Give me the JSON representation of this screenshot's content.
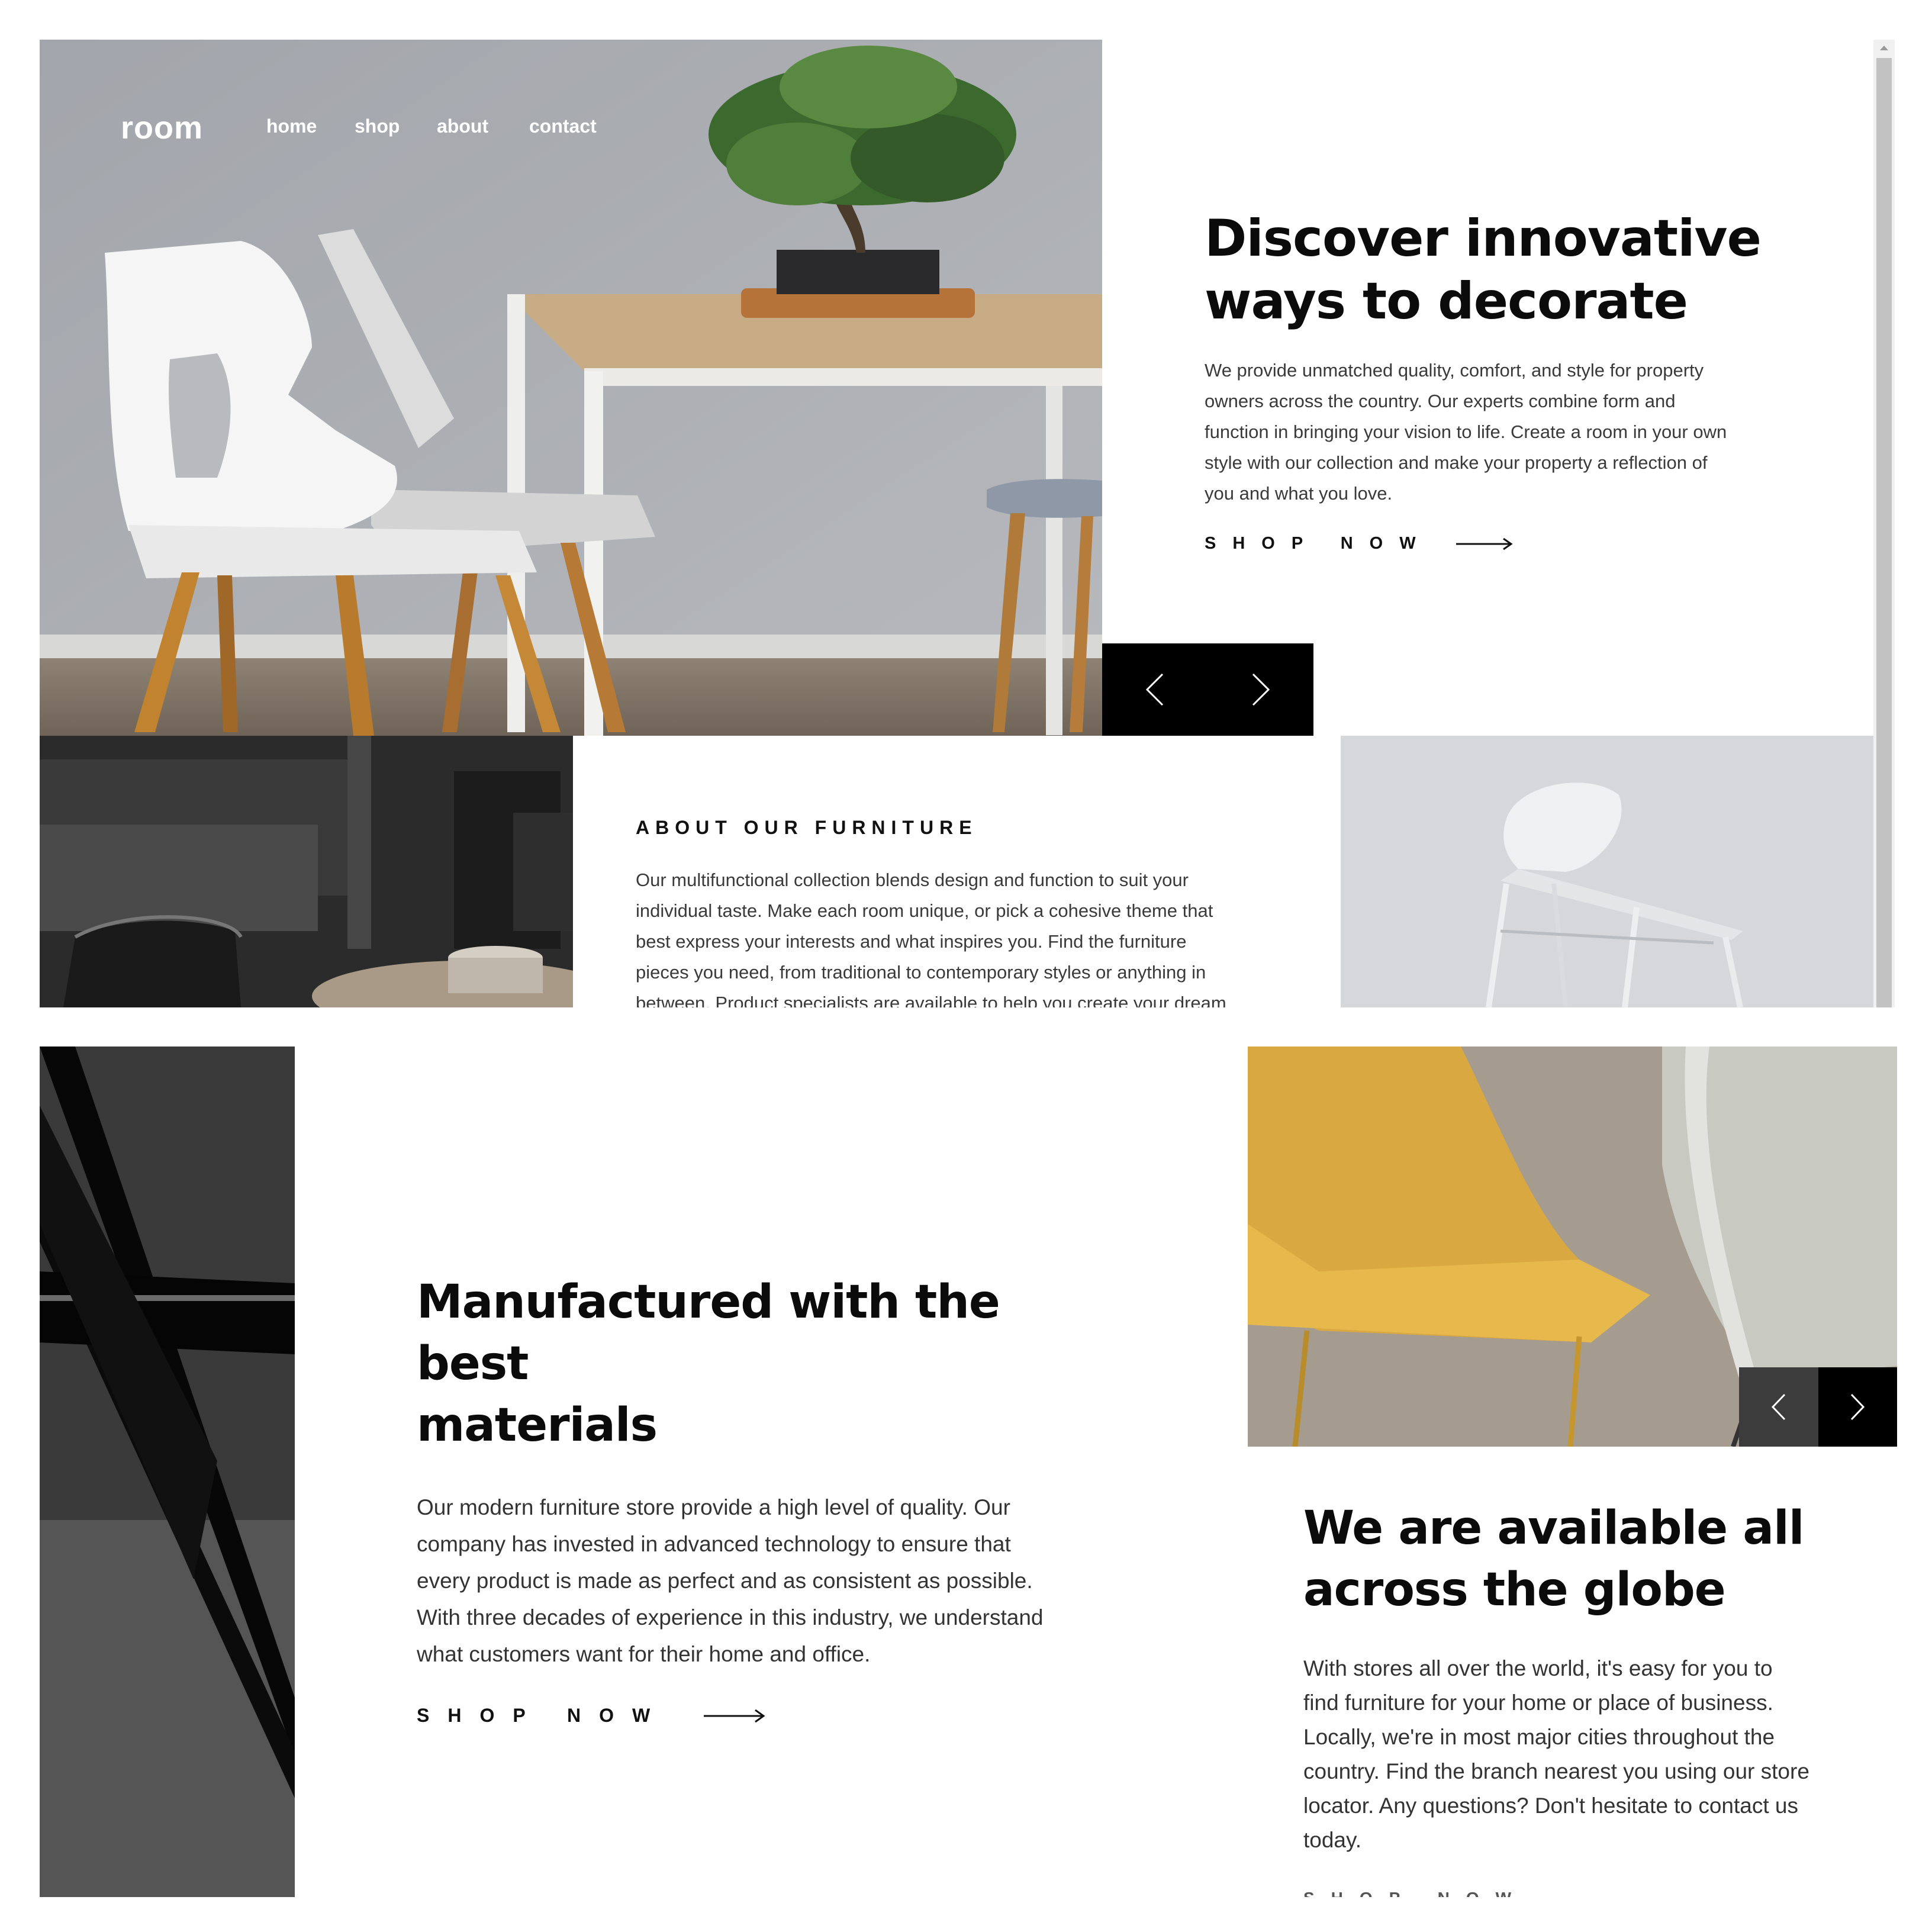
{
  "nav": {
    "logo": "room",
    "links": [
      "home",
      "shop",
      "about",
      "contact"
    ]
  },
  "hero": {
    "heading_line1": "Discover innovative",
    "heading_line2": "ways to decorate",
    "body_lines": [
      "We provide unmatched quality, comfort, and style for property",
      "owners across the country. Our experts combine form and",
      "function in bringing your vision to life. Create a room in your own",
      "style with our collection and make your property a reflection of",
      "you and what you love."
    ],
    "cta": "SHOP NOW"
  },
  "about": {
    "heading": "ABOUT OUR FURNITURE",
    "body_lines": [
      "Our multifunctional collection blends design and function to suit your",
      "individual taste. Make each room unique, or pick a cohesive theme that",
      "best express your interests and what inspires you. Find the furniture",
      "pieces you need, from traditional to contemporary styles or anything in",
      "between. Product specialists are available to help you create your dream"
    ]
  },
  "materials": {
    "heading_line1": "Manufactured with the best",
    "heading_line2": "materials",
    "body_lines": [
      "Our modern furniture store provide a high level of quality. Our",
      "company has invested in advanced technology to ensure that",
      "every product is made as perfect and as consistent as possible.",
      "With three decades of experience in this industry, we understand",
      "what customers want for their home and office."
    ],
    "cta": "SHOP NOW"
  },
  "globe": {
    "heading_line1": "We are available all",
    "heading_line2": "across the globe",
    "body_lines": [
      "With stores all over the world, it's easy for you to",
      "find furniture for your home or place of business.",
      "Locally, we're in most major cities throughout the",
      "country. Find the branch nearest you using our store",
      "locator. Any questions? Don't hesitate to contact us",
      "today."
    ],
    "cut_text": "SHOP NOW"
  },
  "colors": {
    "accent_dark": "#000000",
    "text": "#111111",
    "body_text": "#3a3a3a",
    "wall_gray": "#a9abb0",
    "chair_yellow": "#d9a840"
  },
  "icons": [
    "chevron-left-icon",
    "chevron-right-icon",
    "arrow-right-icon",
    "scroll-up-arrow-icon"
  ]
}
